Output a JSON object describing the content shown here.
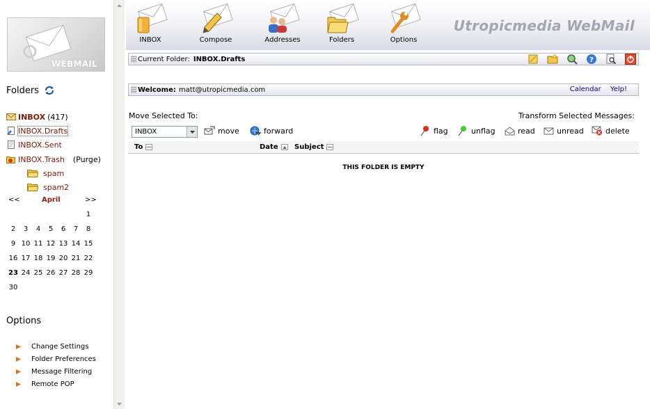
{
  "sidebar": {
    "logo_text": "WEBMAIL",
    "folders_heading": "Folders",
    "folders": [
      {
        "name": "INBOX",
        "count": "(417)"
      },
      {
        "name": "INBOX.Drafts"
      },
      {
        "name": "INBOX.Sent"
      },
      {
        "name": "INBOX.Trash",
        "purge": "(Purge)"
      },
      {
        "name": "spam"
      },
      {
        "name": "spam2"
      }
    ],
    "calendar": {
      "prev": "<<",
      "month": "April",
      "next": ">>",
      "weeks": [
        [
          "",
          "",
          "",
          "",
          "",
          "",
          "1"
        ],
        [
          "2",
          "3",
          "4",
          "5",
          "6",
          "7",
          "8"
        ],
        [
          "9",
          "10",
          "11",
          "12",
          "13",
          "14",
          "15"
        ],
        [
          "16",
          "17",
          "18",
          "19",
          "20",
          "21",
          "22"
        ],
        [
          "23",
          "24",
          "25",
          "26",
          "27",
          "28",
          "29"
        ],
        [
          "30",
          "",
          "",
          "",
          "",
          "",
          ""
        ]
      ],
      "today": "23"
    },
    "options_heading": "Options",
    "options": [
      "Change Settings",
      "Folder Preferences",
      "Message Filtering",
      "Remote POP"
    ]
  },
  "nav": {
    "inbox": "INBOX",
    "compose": "Compose",
    "addresses": "Addresses",
    "folders": "Folders",
    "options": "Options"
  },
  "brand": "Utropicmedia WebMail",
  "folder_bar": {
    "label": "Current Folder:",
    "value": "INBOX.Drafts"
  },
  "welcome_bar": {
    "label": "Welcome:",
    "email": "matt@utropicmedia.com",
    "links": [
      "Calendar",
      "Yelp!"
    ]
  },
  "move": {
    "label": "Move Selected To:",
    "selected_folder": "INBOX",
    "move_label": "move",
    "forward_label": "forward"
  },
  "transform": {
    "label": "Transform Selected Messages:",
    "flag": "flag",
    "unflag": "unflag",
    "read": "read",
    "unread": "unread",
    "delete": "delete"
  },
  "table": {
    "columns": [
      "To",
      "Date",
      "Subject"
    ],
    "empty_message": "THIS FOLDER IS EMPTY"
  },
  "colors": {
    "folder_link": "#7a1a0a",
    "month": "#8b1a1a",
    "link": "#00008b",
    "brand": "#a4a5b3"
  }
}
